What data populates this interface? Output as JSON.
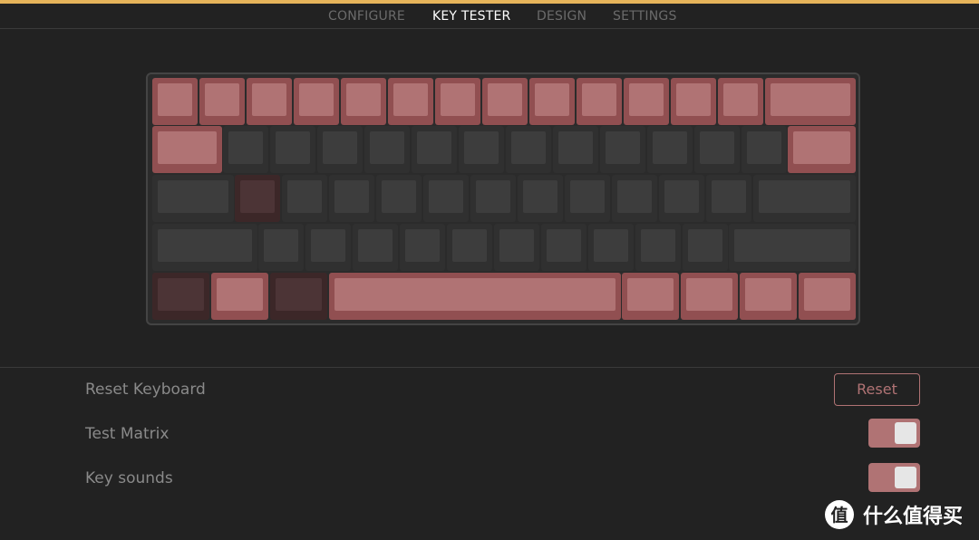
{
  "nav": {
    "tabs": [
      {
        "label": "CONFIGURE",
        "active": false
      },
      {
        "label": "KEY TESTER",
        "active": true
      },
      {
        "label": "DESIGN",
        "active": false
      },
      {
        "label": "SETTINGS",
        "active": false
      }
    ]
  },
  "keyboard": {
    "state_legend": {
      "pressed": "pink",
      "untested": "gray",
      "held": "dark-red"
    },
    "rows": [
      [
        "pink",
        "pink",
        "pink",
        "pink",
        "pink",
        "pink",
        "pink",
        "pink",
        "pink",
        "pink",
        "pink",
        "pink",
        "pink",
        "pink"
      ],
      [
        "pink",
        "gray",
        "gray",
        "gray",
        "gray",
        "gray",
        "gray",
        "gray",
        "gray",
        "gray",
        "gray",
        "gray",
        "gray",
        "pink"
      ],
      [
        "gray",
        "dark-red",
        "gray",
        "gray",
        "gray",
        "gray",
        "gray",
        "gray",
        "gray",
        "gray",
        "gray",
        "gray",
        "gray"
      ],
      [
        "gray",
        "gray",
        "gray",
        "gray",
        "gray",
        "gray",
        "gray",
        "gray",
        "gray",
        "gray",
        "gray",
        "gray"
      ],
      [
        "dark-red",
        "pink",
        "dark-red",
        "pink",
        "pink",
        "pink",
        "pink",
        "pink"
      ]
    ]
  },
  "settings": {
    "reset_label": "Reset Keyboard",
    "reset_button": "Reset",
    "test_matrix_label": "Test Matrix",
    "test_matrix_on": true,
    "key_sounds_label": "Key sounds",
    "key_sounds_on": true
  },
  "colors": {
    "accent": "#b07374",
    "background": "#222222",
    "top_accent": "#e6b45a",
    "key_pressed": "#b07374",
    "key_untested": "#3d3d3d",
    "key_held": "#4c3436"
  },
  "watermark": {
    "text": "什么值得买",
    "icon": "zhi-logo-icon"
  }
}
